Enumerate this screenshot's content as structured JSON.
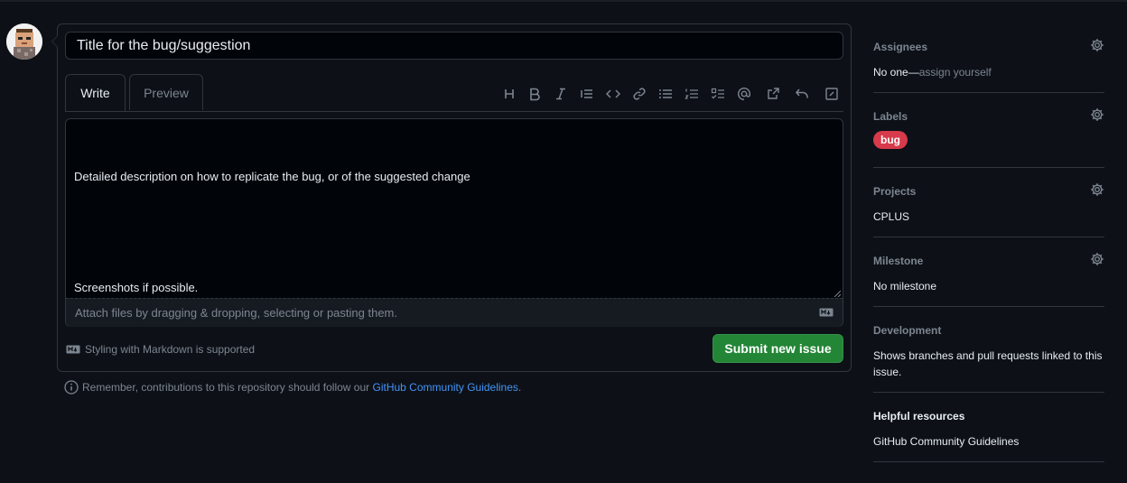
{
  "issue_form": {
    "title_value": "Title for the bug/suggestion",
    "tabs": [
      {
        "label": "Write"
      },
      {
        "label": "Preview"
      }
    ],
    "toolbar_icons": [
      "heading-icon",
      "bold-icon",
      "italic-icon",
      "quote-icon",
      "code-icon",
      "link-icon",
      "unordered-list-icon",
      "ordered-list-icon",
      "task-list-icon",
      "mention-icon",
      "cross-reference-icon",
      "undo-icon",
      "fullscreen-icon"
    ],
    "body_line1": "Detailed description on how to replicate the bug, or of the suggested change",
    "body_line2": "Screenshots if possible.",
    "attach_text": "Attach files by dragging & dropping, selecting or pasting them.",
    "markdown_note": "Styling with Markdown is supported",
    "submit_label": "Submit new issue"
  },
  "footer": {
    "remember_prefix": "Remember, contributions to this repository should follow our ",
    "guidelines_link": "GitHub Community Guidelines",
    "remember_suffix": "."
  },
  "sidebar": {
    "assignees": {
      "heading": "Assignees",
      "value_prefix": "No one—",
      "assign_link": "assign yourself"
    },
    "labels": {
      "heading": "Labels",
      "items": [
        "bug"
      ],
      "label_color": "#d73a4a"
    },
    "projects": {
      "heading": "Projects",
      "value": "CPLUS"
    },
    "milestone": {
      "heading": "Milestone",
      "value": "No milestone"
    },
    "development": {
      "heading": "Development",
      "value": "Shows branches and pull requests linked to this issue."
    },
    "helpful": {
      "heading": "Helpful resources",
      "link": "GitHub Community Guidelines"
    }
  },
  "colors": {
    "background": "#0d1117",
    "accent_green": "#238636",
    "link_blue": "#4493f8",
    "border": "#30363d"
  }
}
